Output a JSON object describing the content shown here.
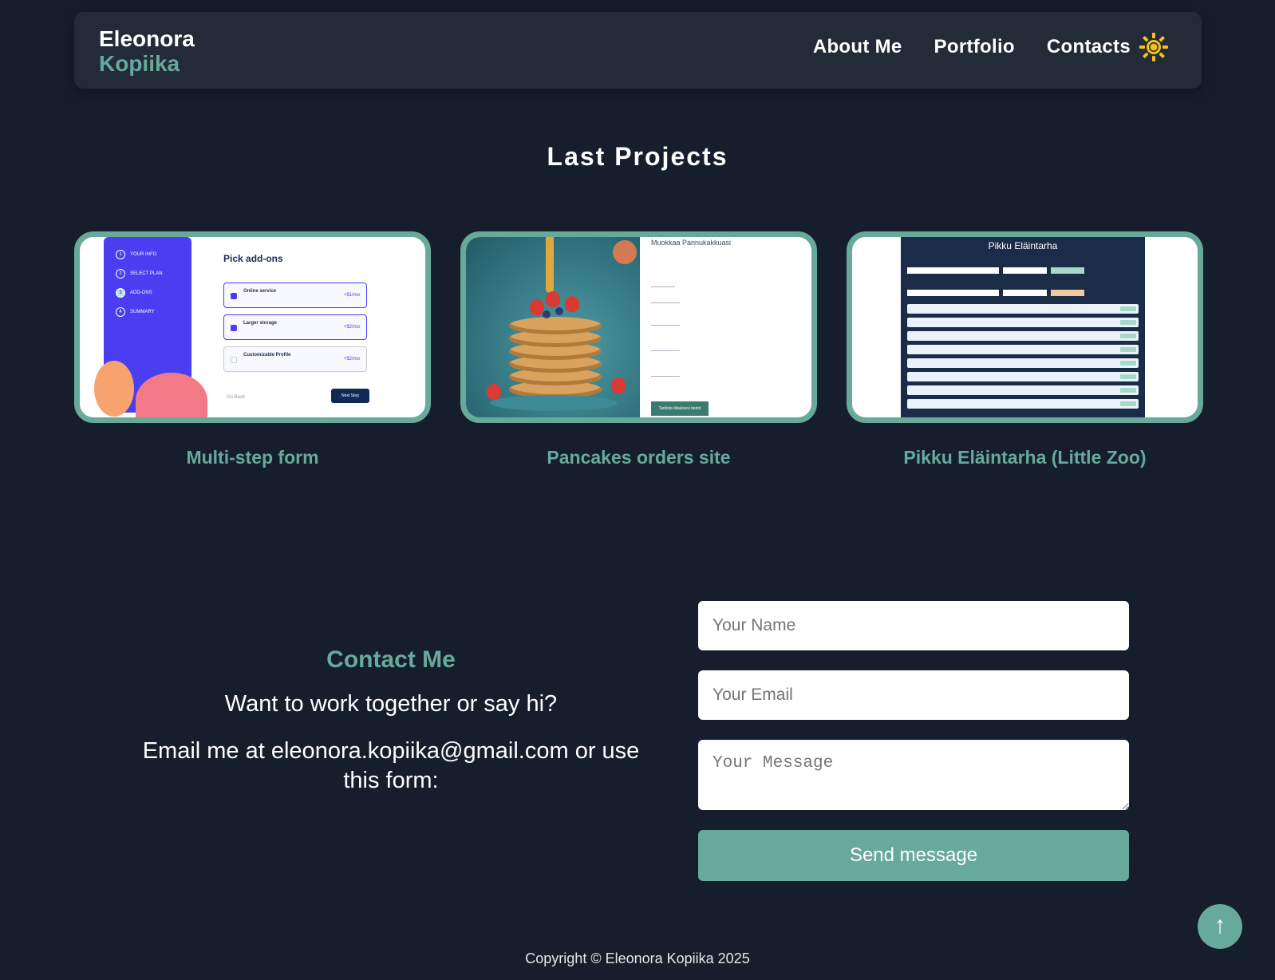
{
  "header": {
    "logo_first": "Eleonora",
    "logo_last": "Kopiika",
    "nav": [
      "About Me",
      "Portfolio",
      "Contacts"
    ],
    "theme_icon": "sun-icon"
  },
  "projects": {
    "title": "Last Projects",
    "items": [
      {
        "caption": "Multi-step form",
        "thumb": {
          "steps": [
            "YOUR INFO",
            "SELECT PLAN",
            "ADD-ONS",
            "SUMMARY"
          ],
          "heading": "Pick add-ons",
          "options": [
            {
              "label": "Online service",
              "price": "+$1/mo"
            },
            {
              "label": "Larger storage",
              "price": "+$2/mo"
            },
            {
              "label": "Customizable Profile",
              "price": "+$2/mo"
            }
          ],
          "back": "Go Back",
          "next": "Next Step"
        }
      },
      {
        "caption": "Pancakes orders site",
        "thumb": {
          "heading": "Muokkaa Pannukakkuasi",
          "button": "Tarkista tilauksesi tiedot"
        }
      },
      {
        "caption": "Pikku Eläintarha (Little Zoo)",
        "thumb": {
          "heading": "Pikku Eläintarha"
        }
      }
    ]
  },
  "contact": {
    "title": "Contact Me",
    "question": "Want to work together or say hi?",
    "email_text": "Email me at eleonora.kopiika@gmail.com or use this form:",
    "name_placeholder": "Your Name",
    "email_placeholder": "Your Email",
    "message_placeholder": "Your Message",
    "send_label": "Send message"
  },
  "scroll_top": "↑",
  "footer": "Copyright © Eleonora Kopiika 2025",
  "colors": {
    "accent": "#67a99b",
    "background": "#161e2d",
    "header": "#232a38",
    "sun": "#f2c21b"
  }
}
